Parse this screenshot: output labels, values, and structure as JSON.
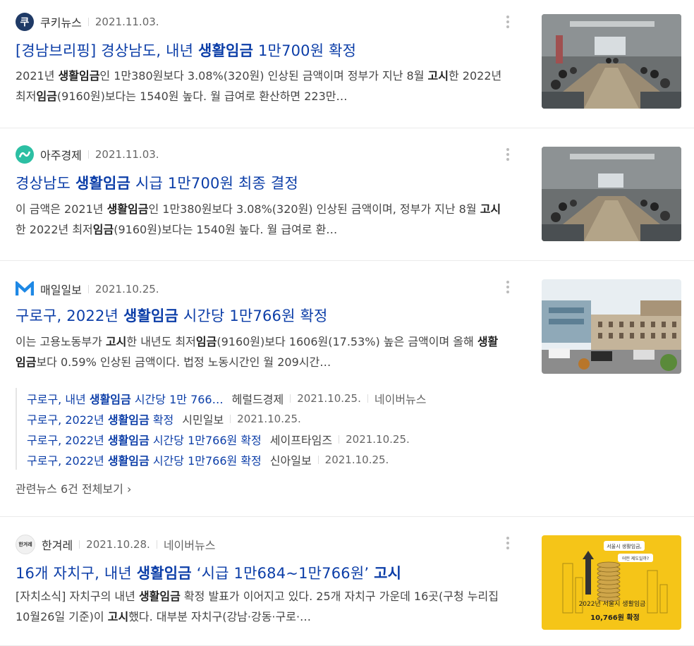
{
  "articles": [
    {
      "press": "쿠키뉴스",
      "date": "2021.11.03.",
      "title_pre": "[경남브리핑] 경상남도, 내년 ",
      "title_hl": "생활임금",
      "title_post": " 1만700원 확정",
      "desc_1": "2021년 ",
      "desc_1b": "생활임금",
      "desc_2": "인 1만380원보다 3.08%(320원) 인상된 금액이며 정부가 지난 8월 ",
      "desc_2b": "고시",
      "desc_3": "한 2022년 최저",
      "desc_3b": "임금",
      "desc_4": "(9160원)보다는 1540원 높다. 월 급여로 환산하면 223만…"
    },
    {
      "press": "아주경제",
      "date": "2021.11.03.",
      "title_pre": "경상남도 ",
      "title_hl": "생활임금",
      "title_post": " 시급 1만700원 최종 결정",
      "desc_1": "이 금액은 2021년 ",
      "desc_1b": "생활임금",
      "desc_2": "인 1만380원보다 3.08%(320원) 인상된 금액이며, 정부가 지난 8월 ",
      "desc_2b": "고시",
      "desc_3": "한 2022년 최저",
      "desc_3b": "임금",
      "desc_4": "(9160원)보다는 1540원 높다. 월 급여로 환…"
    },
    {
      "press": "매일일보",
      "date": "2021.10.25.",
      "title_pre": "구로구, 2022년 ",
      "title_hl": "생활임금",
      "title_post": " 시간당 1만766원 확정",
      "desc_1": "이는 고용노동부가 ",
      "desc_1b": "고시",
      "desc_2": "한 내년도 최저",
      "desc_2b": "임금",
      "desc_3": "(9160원)보다 1606원(17.53%) 높은 금액이며 올해 ",
      "desc_3b": "생활임금",
      "desc_4": "보다 0.59% 인상된 금액이다. 법정 노동시간인 월 209시간…"
    },
    {
      "press": "한겨레",
      "date": "2021.10.28.",
      "naver": "네이버뉴스",
      "title_pre": "16개 자치구, 내년 ",
      "title_hl": "생활임금",
      "title_mid": " ‘시급 1만684~1만766원’ ",
      "title_hl2": "고시",
      "desc_1": "[자치소식] 자치구의 내년 ",
      "desc_1b": "생활임금",
      "desc_2": " 확정 발표가 이어지고 있다. 25개 자치구 가운데 16곳(구청 누리집 10월26일 기준)이 ",
      "desc_2b": "고시",
      "desc_3": "했다. 대부분 자치구(강남·강동·구로·…"
    }
  ],
  "related": [
    {
      "pre": "구로구, 내년 ",
      "hl": "생활임금",
      "post": " 시간당 1만 766…",
      "press": "헤럴드경제",
      "date": "2021.10.25.",
      "naver": "네이버뉴스"
    },
    {
      "pre": "구로구, 2022년 ",
      "hl": "생활임금",
      "post": " 확정",
      "press": "시민일보",
      "date": "2021.10.25."
    },
    {
      "pre": "구로구, 2022년 ",
      "hl": "생활임금",
      "post": " 시간당 1만766원 확정",
      "press": "세이프타임즈",
      "date": "2021.10.25."
    },
    {
      "pre": "구로구, 2022년 ",
      "hl": "생활임금",
      "post": " 시간당 1만766원 확정",
      "press": "신아일보",
      "date": "2021.10.25."
    }
  ],
  "related_more": "관련뉴스 6건 전체보기",
  "more_chevron": "›",
  "logos": {
    "kuki": "쿠",
    "hani": "한겨레"
  },
  "thumb4": {
    "line1": "서울시 생활임금,",
    "line2": "어떤 제도일까?",
    "line3": "2022년 서울시 생활임금",
    "line4": "10,766원 확정"
  }
}
